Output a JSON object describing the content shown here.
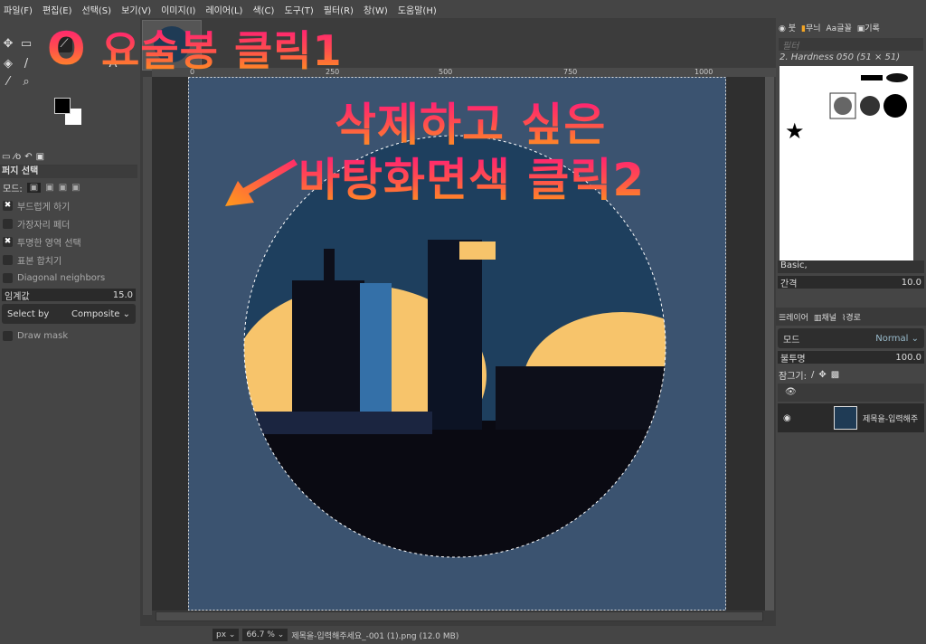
{
  "menu": [
    "파일(F)",
    "편집(E)",
    "선택(S)",
    "보기(V)",
    "이미지(I)",
    "레이어(L)",
    "색(C)",
    "도구(T)",
    "필터(R)",
    "창(W)",
    "도움말(H)"
  ],
  "annotations": {
    "step1": "요술봉 클릭1",
    "step2_line1": "삭제하고 싶은",
    "step2_line2": "바탕화면색 클릭2"
  },
  "tool_options": {
    "title": "퍼지 선택",
    "mode_label": "모드:",
    "antialias": "부드럽게 하기",
    "feather": "가장자리 페더",
    "transparent": "투명한 영역 선택",
    "sample_merged": "표본 합치기",
    "diagonal": "Diagonal neighbors",
    "threshold_label": "임계값",
    "threshold": "15.0",
    "select_by_label": "Select by",
    "select_by": "Composite",
    "draw_mask": "Draw mask"
  },
  "ruler": [
    "0",
    "250",
    "500",
    "750",
    "1000"
  ],
  "status": {
    "unit": "px",
    "zoom": "66.7 %",
    "file": "제목을-입력해주세요_-001 (1).png (12.0 MB)"
  },
  "brushes": {
    "tabs": [
      "붓",
      "무늬",
      "글꼴",
      "기록"
    ],
    "filter_placeholder": "필터",
    "selected": "2. Hardness 050 (51 × 51)",
    "preset": "Basic,",
    "spacing_label": "간격",
    "spacing": "10.0"
  },
  "layers": {
    "tabs": [
      "레이어",
      "채널",
      "경로"
    ],
    "mode_label": "모드",
    "mode": "Normal",
    "opacity_label": "불투명",
    "opacity": "100.0",
    "lock_label": "잠그기:",
    "layer_name": "제목을-입력해주"
  },
  "colors": {
    "canvas_bg": "#3b5370",
    "accent": "#ff2a6a"
  }
}
